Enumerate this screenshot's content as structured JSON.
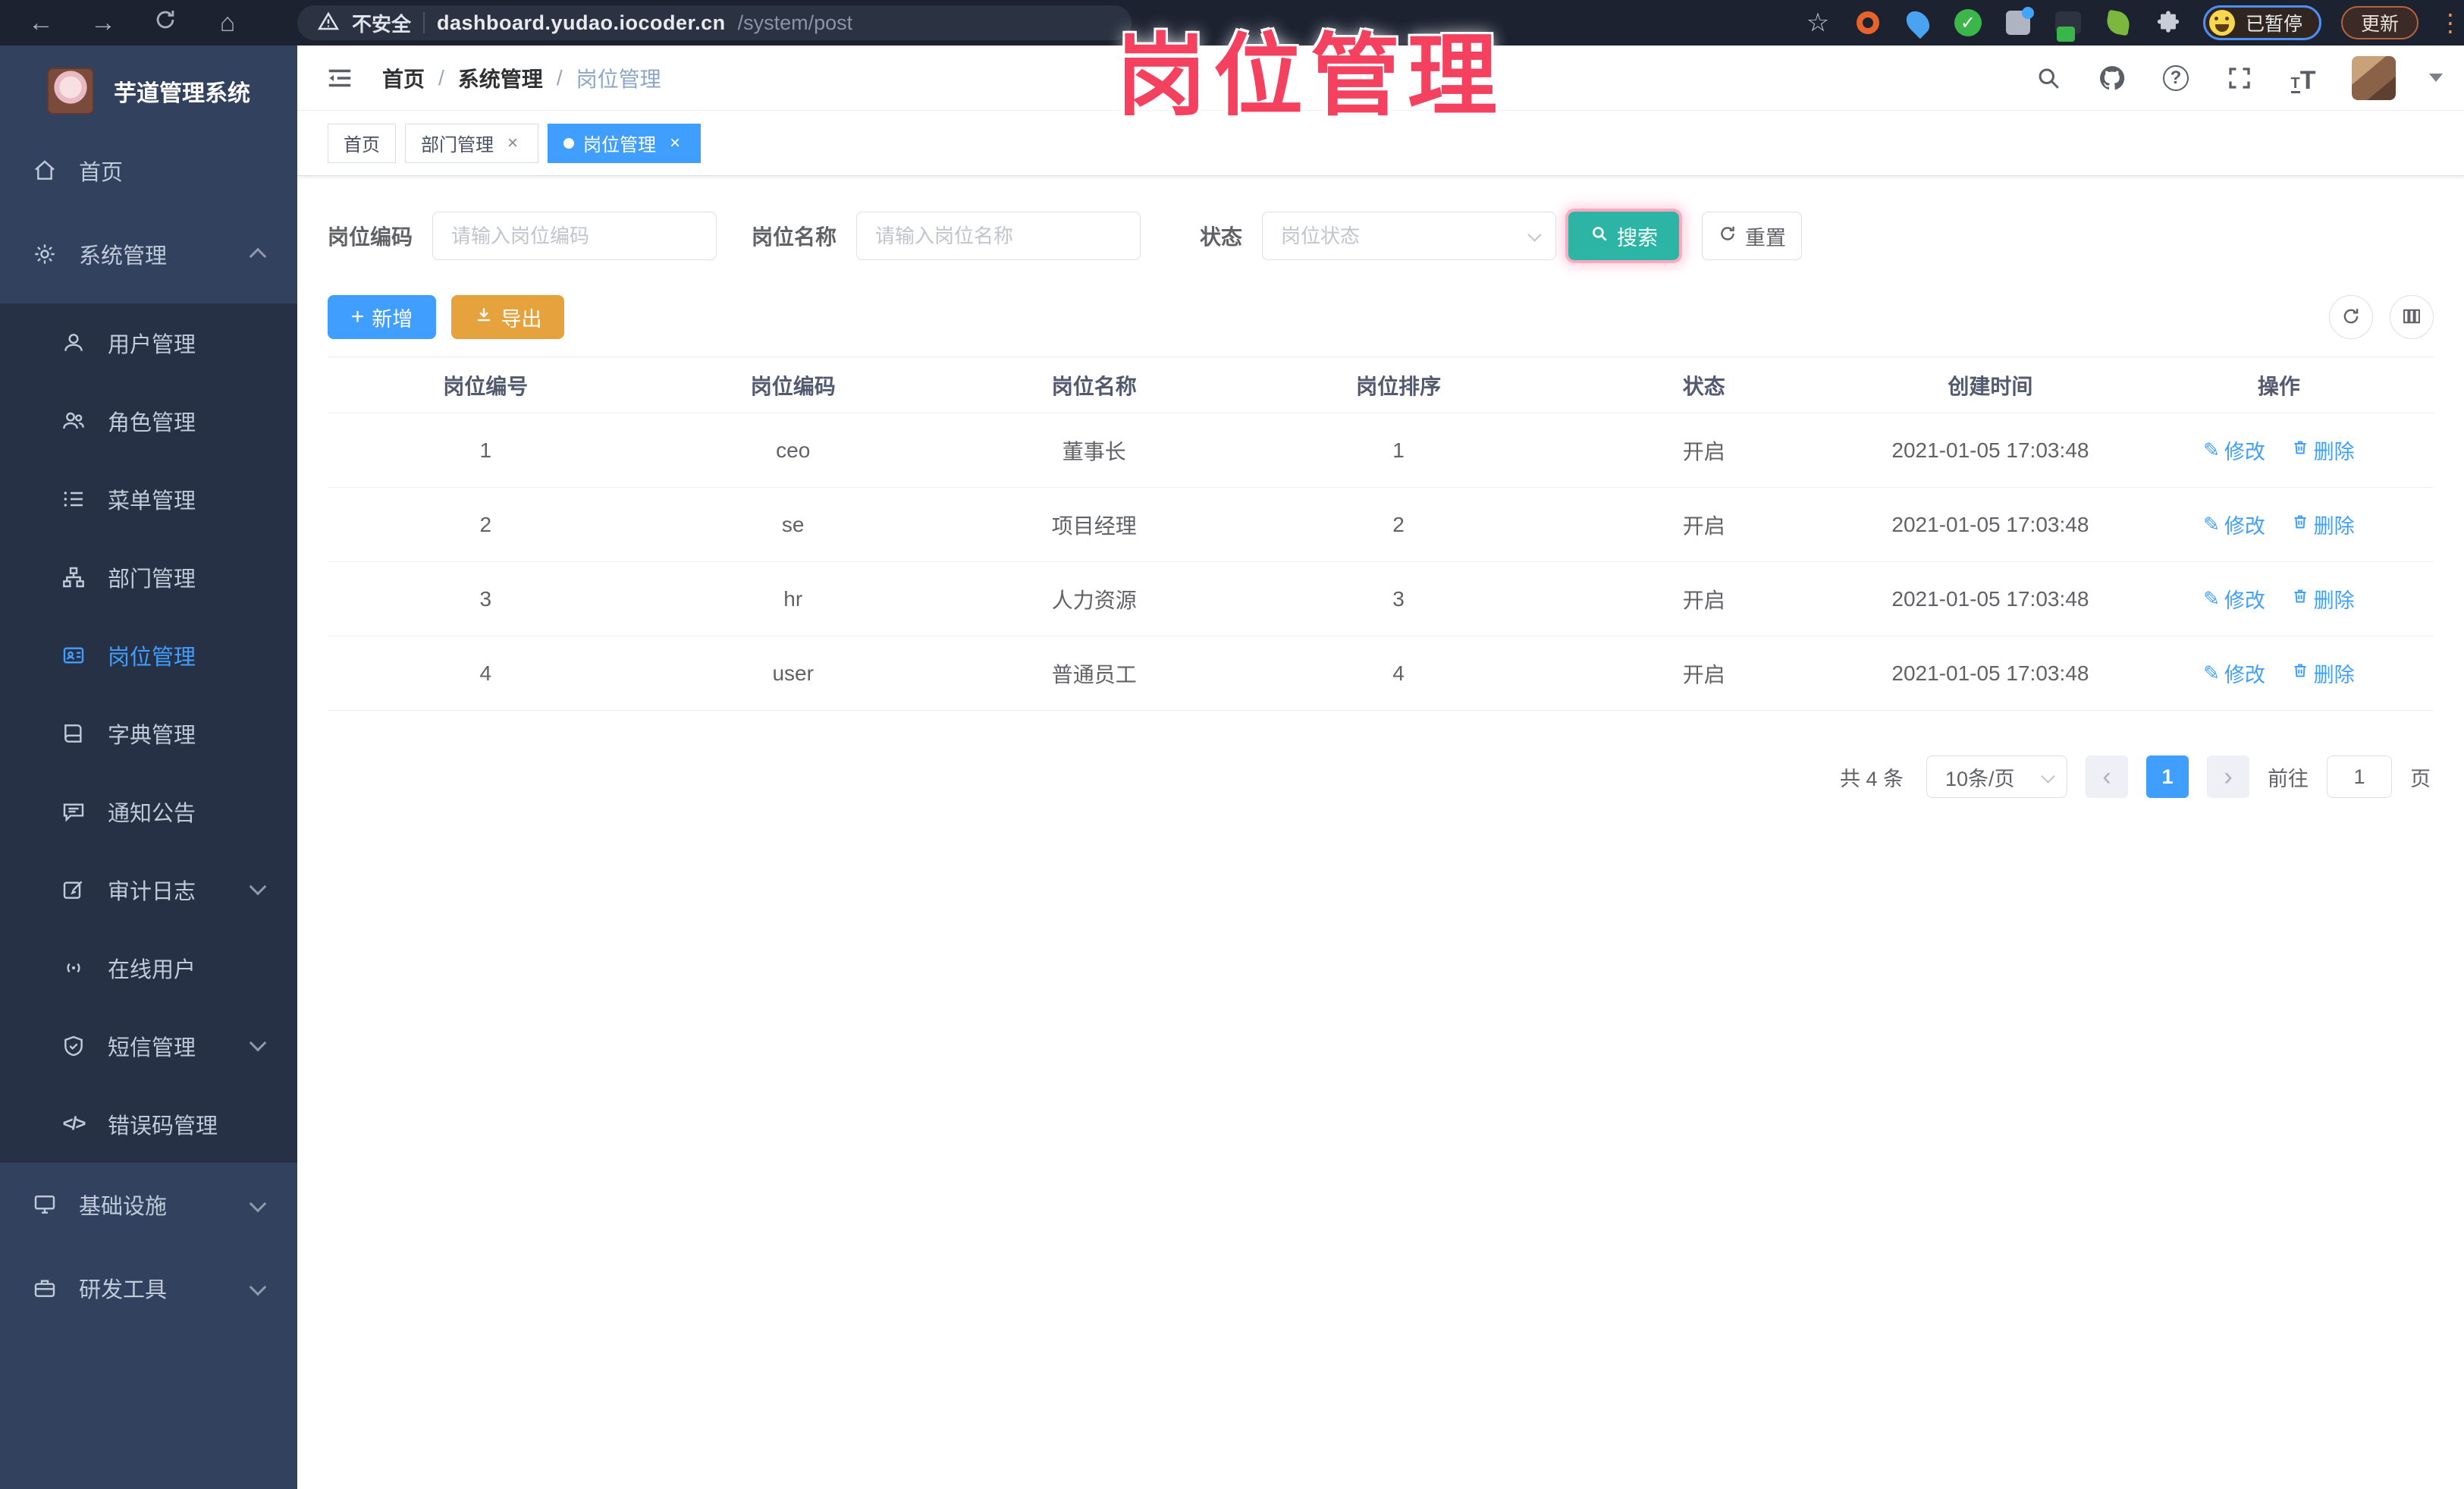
{
  "overlay": {
    "title": "岗位管理"
  },
  "browser": {
    "security": "不安全",
    "url_host": "dashboard.yudao.iocoder.cn",
    "url_path": "/system/post",
    "profile_status": "已暂停",
    "update_label": "更新"
  },
  "icons": {
    "back": "←",
    "forward": "→",
    "home": "⌂",
    "star": "☆",
    "close": "×",
    "question": "?",
    "check": "✓",
    "prev": "‹",
    "next": "›",
    "plus": "+",
    "edit": "✎",
    "kebab": "⋮",
    "slash": "/",
    "errcode": "</>",
    "font_size": "T"
  },
  "sidebar": {
    "title": "芋道管理系统",
    "home": "首页",
    "system": "系统管理",
    "sub": [
      "用户管理",
      "角色管理",
      "菜单管理",
      "部门管理",
      "岗位管理",
      "字典管理",
      "通知公告",
      "审计日志",
      "在线用户",
      "短信管理",
      "错误码管理"
    ],
    "infra": "基础设施",
    "dev": "研发工具"
  },
  "header": {
    "breadcrumb": [
      "首页",
      "系统管理",
      "岗位管理"
    ]
  },
  "tabs": {
    "items": [
      "首页",
      "部门管理",
      "岗位管理"
    ]
  },
  "form": {
    "code_label": "岗位编码",
    "code_placeholder": "请输入岗位编码",
    "name_label": "岗位名称",
    "name_placeholder": "请输入岗位名称",
    "status_label": "状态",
    "status_placeholder": "岗位状态",
    "search": "搜索",
    "reset": "重置"
  },
  "toolbar": {
    "add": "新增",
    "export": "导出"
  },
  "table": {
    "headers": [
      "岗位编号",
      "岗位编码",
      "岗位名称",
      "岗位排序",
      "状态",
      "创建时间",
      "操作"
    ],
    "rows": [
      {
        "id": "1",
        "code": "ceo",
        "name": "董事长",
        "sort": "1",
        "status": "开启",
        "time": "2021-01-05 17:03:48"
      },
      {
        "id": "2",
        "code": "se",
        "name": "项目经理",
        "sort": "2",
        "status": "开启",
        "time": "2021-01-05 17:03:48"
      },
      {
        "id": "3",
        "code": "hr",
        "name": "人力资源",
        "sort": "3",
        "status": "开启",
        "time": "2021-01-05 17:03:48"
      },
      {
        "id": "4",
        "code": "user",
        "name": "普通员工",
        "sort": "4",
        "status": "开启",
        "time": "2021-01-05 17:03:48"
      }
    ],
    "actions": {
      "edit": "修改",
      "del": "删除"
    }
  },
  "pagination": {
    "total": "共 4 条",
    "page_size": "10条/页",
    "active_page": "1",
    "goto_label": "前往",
    "page_unit": "页",
    "page_input": "1"
  },
  "colors": {
    "accent": "#409eff",
    "search_button": "#2cb5a5",
    "export_button": "#e6a23c",
    "overlay_text": "#f4415f",
    "sidebar_bg": "#32415e",
    "submenu_bg": "#263146",
    "browser_bar_bg": "#1c2230"
  }
}
